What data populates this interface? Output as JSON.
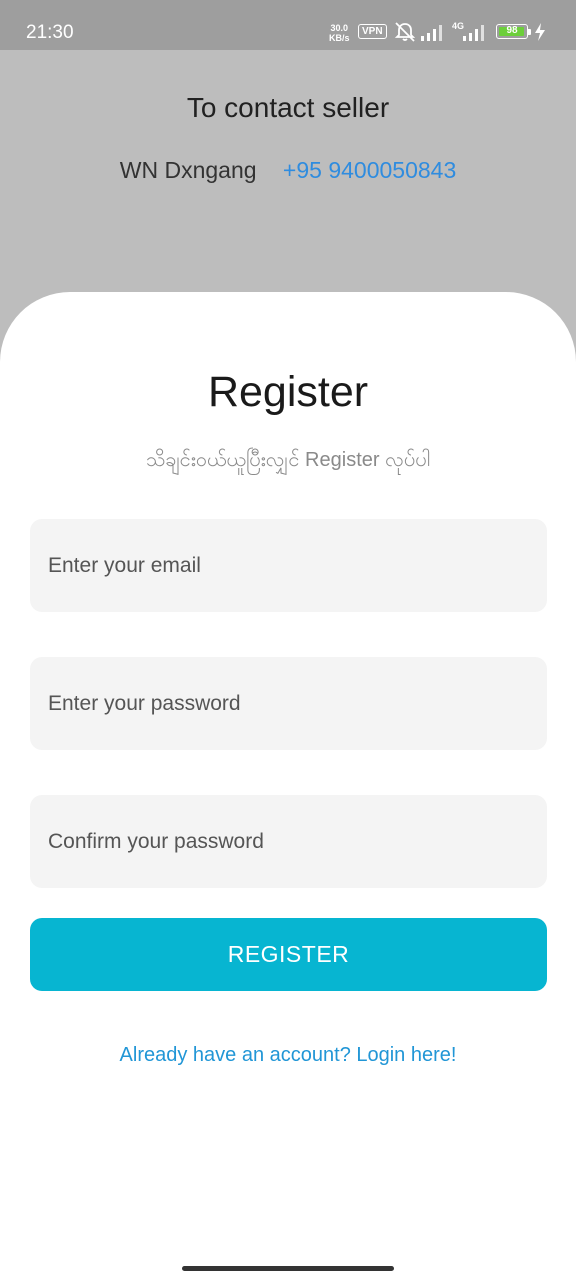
{
  "status_bar": {
    "time": "21:30",
    "net_speed_value": "30.0",
    "net_speed_unit": "KB/s",
    "vpn": "VPN",
    "network_type": "4G",
    "battery_level": 98,
    "battery_label": "98",
    "colors": {
      "background": "#9e9e9e",
      "battery_fill": "#6ccf3a"
    }
  },
  "contact": {
    "title": "To contact seller",
    "seller_name": "WN Dxngang",
    "seller_phone": "+95 9400050843"
  },
  "register": {
    "title": "Register",
    "subtitle": "သိချင်းဝယ်ယူပြီးလျှင် Register လုပ်ပါ",
    "email_placeholder": "Enter your email",
    "email_value": "",
    "password_placeholder": "Enter your password",
    "password_value": "",
    "confirm_placeholder": "Confirm your password",
    "confirm_value": "",
    "button_label": "REGISTER",
    "login_link": "Already have an account? Login here!"
  },
  "icons": {
    "notifications": "bell-off-icon",
    "signal": "cell-signal-icon",
    "charging": "charging-bolt-icon"
  },
  "colors": {
    "accent": "#07b5d1",
    "link": "#2196d6",
    "phone_link": "#2f8cdf",
    "backdrop": "#bdbdbd",
    "field_background": "#f4f4f4"
  }
}
